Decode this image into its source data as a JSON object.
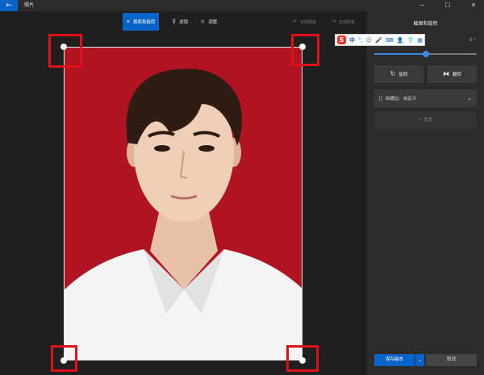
{
  "window": {
    "title": "照片",
    "back_icon": "←",
    "minimize_icon": "─",
    "maximize_icon": "☐",
    "close_icon": "✕"
  },
  "toolbar": {
    "tabs": [
      {
        "label": "裁剪和旋转",
        "icon": "⌗"
      },
      {
        "label": "滤镜",
        "icon": "⊽"
      },
      {
        "label": "调整",
        "icon": "☼"
      }
    ],
    "undo_label": "全部撤销",
    "redo_label": "全部恢复",
    "undo_icon": "↶",
    "redo_icon": "↷"
  },
  "panel": {
    "title": "截图和旋转",
    "straighten_value": "0 °",
    "straighten_level": 0.5,
    "rotate_label": "旋转",
    "rotate_icon": "↻",
    "flip_label": "翻转",
    "flip_icon": "⧓",
    "aspect_label": "纵横比：自定义",
    "aspect_icon": "▯",
    "reset_label": "重置",
    "reset_icon": "↶",
    "save_label": "保存副本",
    "save_drop_icon": "⌄",
    "cancel_label": "取消"
  },
  "ime": {
    "logo": "S",
    "mode": "中",
    "icons": [
      "°,",
      "☺",
      "🎤",
      "⌨",
      "👤",
      "👕",
      "▦"
    ]
  },
  "colors": {
    "accent": "#0a63c9",
    "photo_background": "#b01322",
    "annotation": "#e0101a"
  }
}
